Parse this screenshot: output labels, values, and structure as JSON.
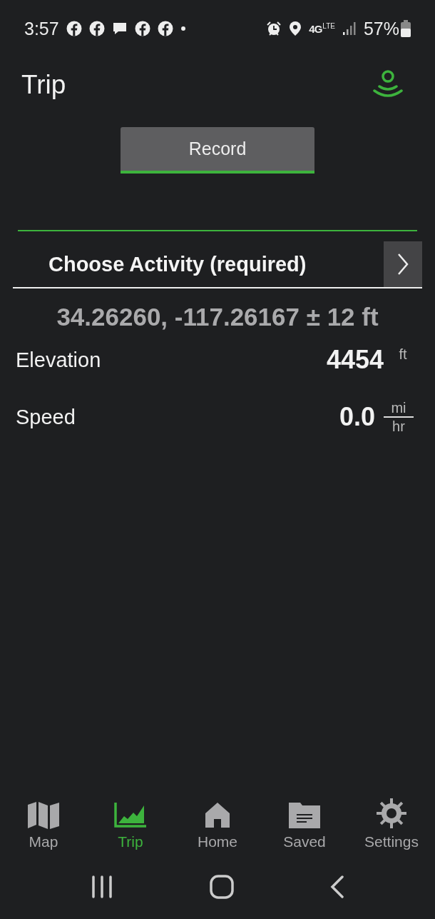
{
  "status_bar": {
    "time": "3:57",
    "notifications": [
      {
        "kind": "facebook"
      },
      {
        "kind": "facebook"
      },
      {
        "kind": "message"
      },
      {
        "kind": "facebook"
      },
      {
        "kind": "facebook"
      },
      {
        "kind": "dot"
      }
    ],
    "network": "4G",
    "network_sub": "LTE",
    "battery": "57%"
  },
  "header": {
    "title": "Trip"
  },
  "record_button": {
    "label": "Record"
  },
  "activity": {
    "label": "Choose Activity (required)"
  },
  "position": {
    "coordinates": "34.26260, -117.26167 ± 12 ft"
  },
  "stats": [
    {
      "kind": "simple",
      "label": "Elevation",
      "value": "4454",
      "unit": "ft"
    },
    {
      "kind": "fraction",
      "label": "Speed",
      "value": "0.0",
      "unit_top": "mi",
      "unit_bottom": "hr"
    }
  ],
  "bottom_nav": [
    {
      "kind": "map",
      "label": "Map",
      "selected": false
    },
    {
      "kind": "chart",
      "label": "Trip",
      "selected": true
    },
    {
      "kind": "home",
      "label": "Home",
      "selected": false
    },
    {
      "kind": "folder",
      "label": "Saved",
      "selected": false
    },
    {
      "kind": "gear",
      "label": "Settings",
      "selected": false
    }
  ]
}
